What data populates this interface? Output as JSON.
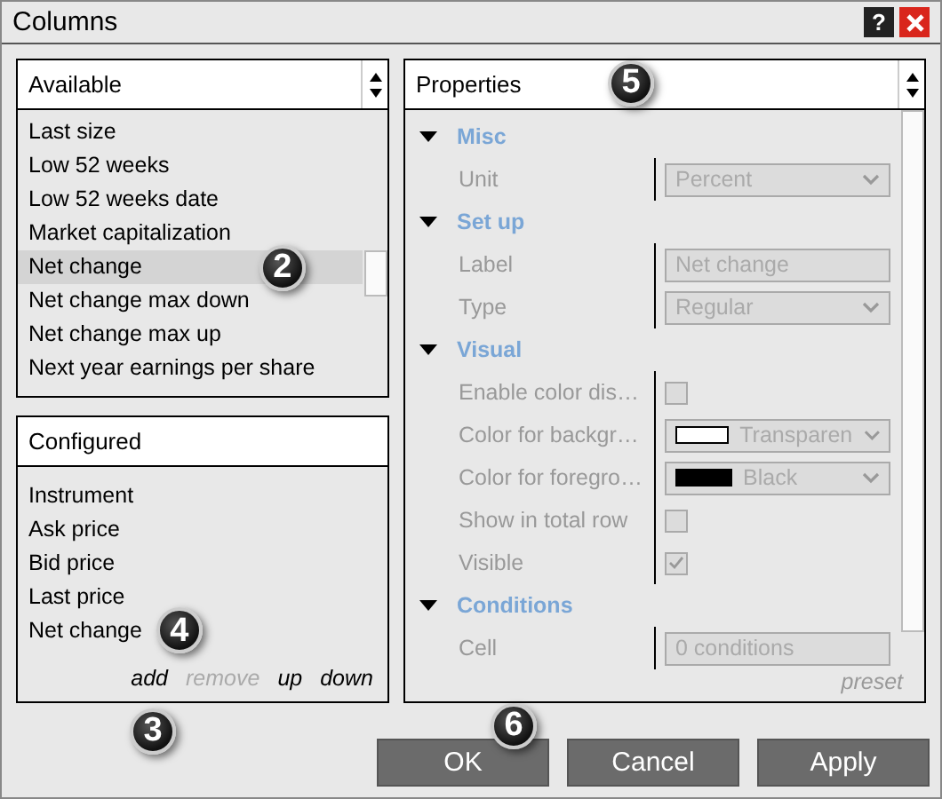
{
  "window": {
    "title": "Columns",
    "help": "?"
  },
  "available": {
    "header": "Available",
    "callout": "2",
    "items": [
      {
        "label": "Last size",
        "selected": false
      },
      {
        "label": "Low 52 weeks",
        "selected": false
      },
      {
        "label": "Low 52 weeks date",
        "selected": false
      },
      {
        "label": "Market capitalization",
        "selected": false
      },
      {
        "label": "Net change",
        "selected": true
      },
      {
        "label": "Net change max down",
        "selected": false
      },
      {
        "label": "Net change max up",
        "selected": false
      },
      {
        "label": "Next year earnings per share",
        "selected": false
      }
    ]
  },
  "configured": {
    "header": "Configured",
    "item_callout": "4",
    "panel_callout": "3",
    "items": [
      {
        "label": "Instrument"
      },
      {
        "label": "Ask price"
      },
      {
        "label": "Bid price"
      },
      {
        "label": "Last price"
      },
      {
        "label": "Net change"
      }
    ],
    "actions": [
      {
        "label": "add",
        "disabled": false
      },
      {
        "label": "remove",
        "disabled": true
      },
      {
        "label": "up",
        "disabled": false
      },
      {
        "label": "down",
        "disabled": false
      }
    ]
  },
  "properties": {
    "header": "Properties",
    "callout": "5",
    "preset": "preset",
    "groups": [
      {
        "label": "Misc",
        "expanded": true,
        "rows": [
          {
            "kind": "select",
            "label": "Unit",
            "value": "Percent"
          }
        ]
      },
      {
        "label": "Set up",
        "expanded": true,
        "rows": [
          {
            "kind": "text",
            "label": "Label",
            "value": "Net change"
          },
          {
            "kind": "select",
            "label": "Type",
            "value": "Regular"
          }
        ]
      },
      {
        "label": "Visual",
        "expanded": true,
        "rows": [
          {
            "kind": "checkbox",
            "label": "Enable color dis…",
            "checked": false
          },
          {
            "kind": "color",
            "label": "Color for backgr…",
            "value": "Transparen",
            "color": "#ffffff"
          },
          {
            "kind": "color",
            "label": "Color for foregro…",
            "value": "Black",
            "color": "#000000"
          },
          {
            "kind": "checkbox",
            "label": "Show in total row",
            "checked": false
          },
          {
            "kind": "checkbox",
            "label": "Visible",
            "checked": true
          }
        ]
      },
      {
        "label": "Conditions",
        "expanded": true,
        "rows": [
          {
            "kind": "text",
            "label": "Cell",
            "value": "0 conditions"
          }
        ]
      }
    ]
  },
  "buttons": [
    {
      "label": "OK",
      "callout": "6"
    },
    {
      "label": "Cancel"
    },
    {
      "label": "Apply"
    }
  ]
}
